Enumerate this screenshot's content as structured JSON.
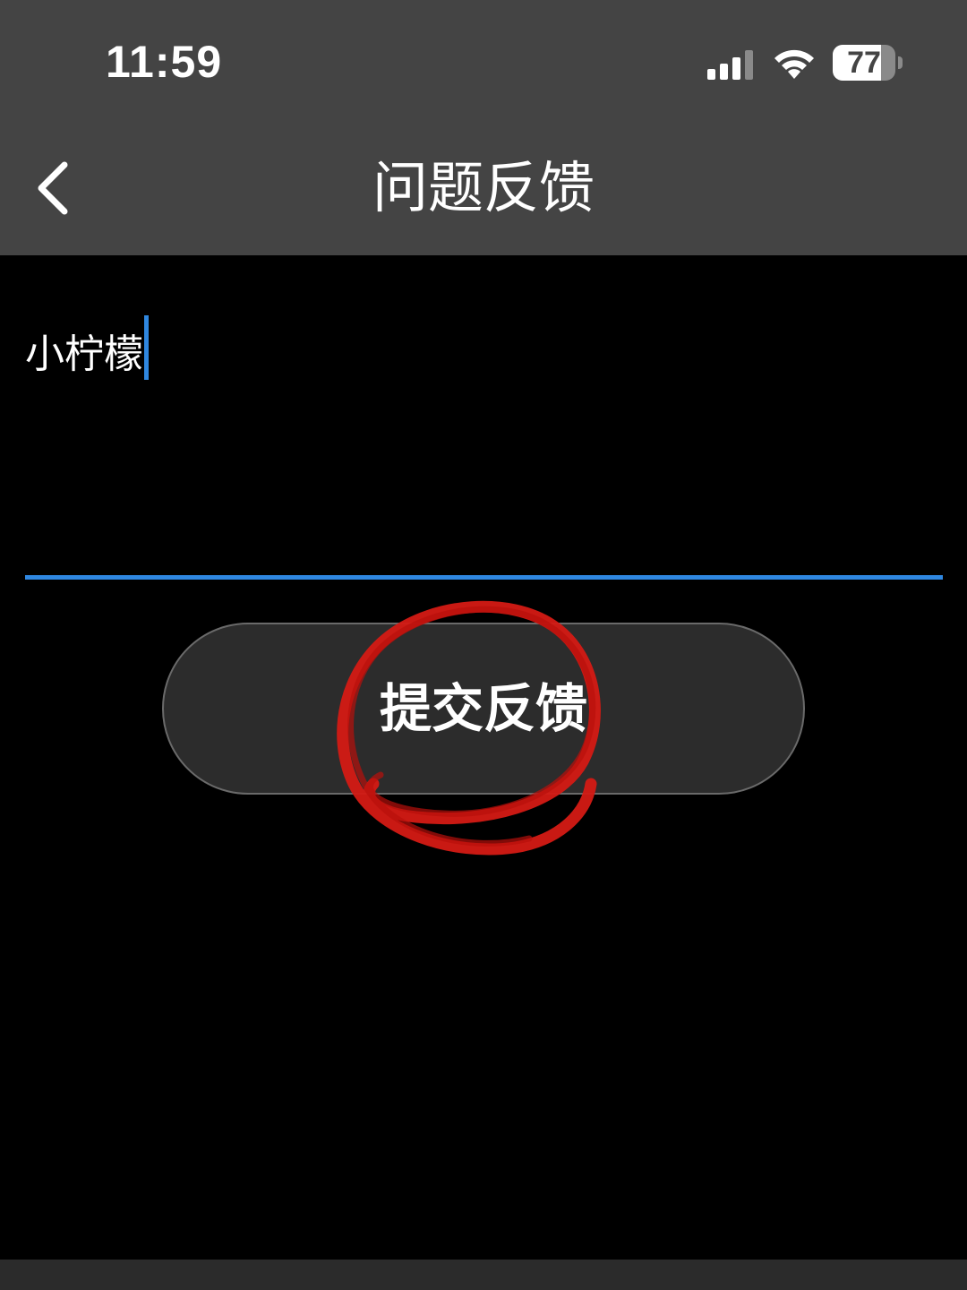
{
  "status_bar": {
    "time": "11:59",
    "battery_level": "77",
    "icons": [
      "signal-icon",
      "wifi-icon",
      "battery-icon"
    ]
  },
  "nav_bar": {
    "back_icon": "chevron-left-icon",
    "title": "问题反馈"
  },
  "feedback": {
    "input_value": "小柠檬"
  },
  "submit": {
    "label": "提交反馈"
  },
  "colors": {
    "header_bg": "#444444",
    "page_bg": "#000000",
    "accent": "#2f87e0",
    "button_bg": "#2c2c2c",
    "annotation": "#d41a14"
  },
  "battery_fraction": 0.77
}
